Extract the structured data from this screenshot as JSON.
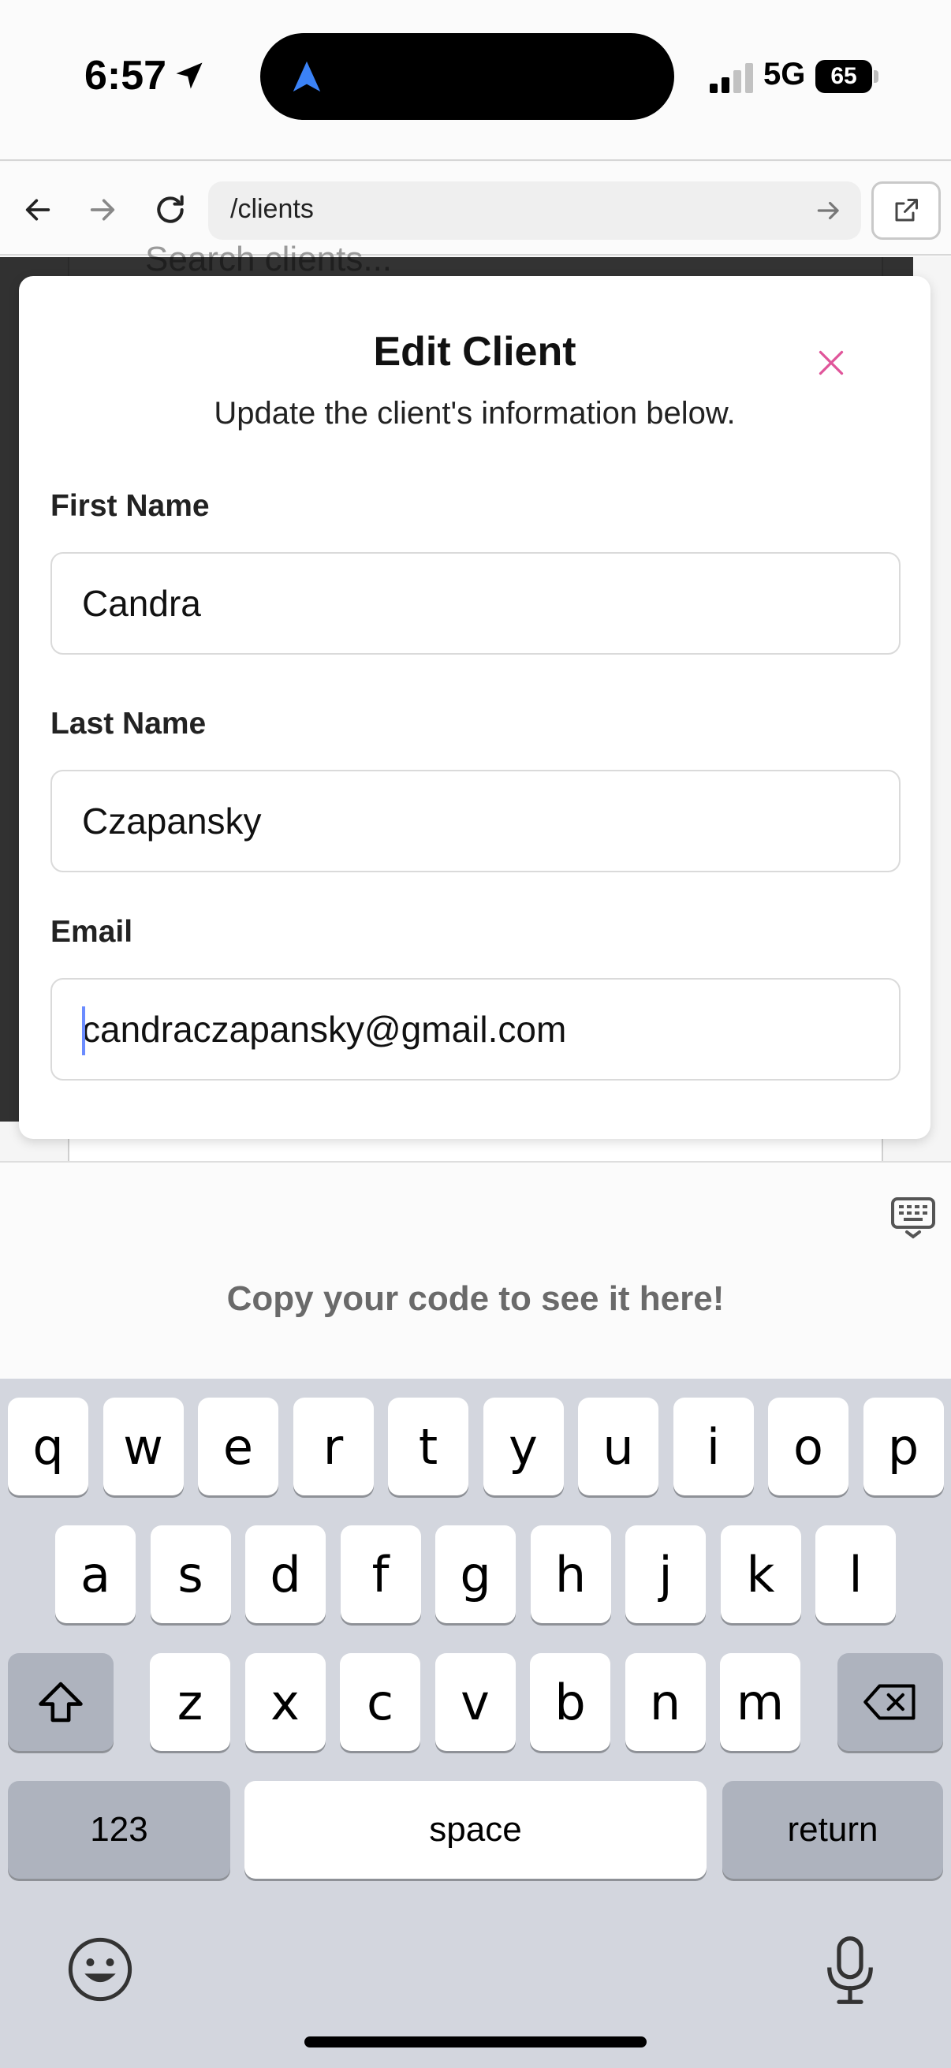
{
  "status_bar": {
    "time": "6:57",
    "network": "5G",
    "battery": "65"
  },
  "browser": {
    "url": "/clients"
  },
  "background_page": {
    "search_placeholder": "Search clients..."
  },
  "dialog": {
    "title": "Edit Client",
    "description": "Update the client's information below.",
    "fields": [
      {
        "label": "First Name",
        "value": "Candra"
      },
      {
        "label": "Last Name",
        "value": "Czapansky"
      },
      {
        "label": "Email",
        "value": "candraczapansky@gmail.com"
      }
    ]
  },
  "preview_hint": "Copy your code to see it here!",
  "keyboard": {
    "row1": [
      "q",
      "w",
      "e",
      "r",
      "t",
      "y",
      "u",
      "i",
      "o",
      "p"
    ],
    "row2": [
      "a",
      "s",
      "d",
      "f",
      "g",
      "h",
      "j",
      "k",
      "l"
    ],
    "row3": [
      "z",
      "x",
      "c",
      "v",
      "b",
      "n",
      "m"
    ],
    "numbers_label": "123",
    "space_label": "space",
    "return_label": "return"
  },
  "colors": {
    "accent_close": "#e0559a",
    "caret": "#6b8cff",
    "keyboard_bg": "#d3d6de"
  },
  "icons": [
    "location-arrow-icon",
    "back-arrow-icon",
    "forward-arrow-icon",
    "reload-icon",
    "external-link-icon",
    "close-icon",
    "keyboard-toggle-icon",
    "shift-icon",
    "backspace-icon",
    "emoji-icon",
    "microphone-icon"
  ]
}
